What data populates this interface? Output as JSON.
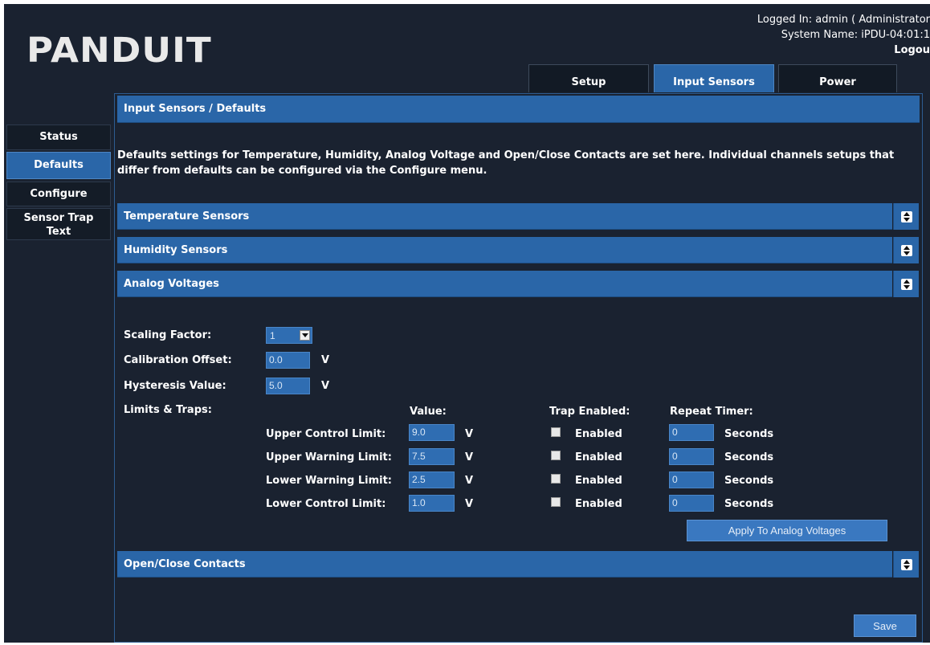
{
  "header": {
    "logo": "PANDUIT",
    "logged_in": "Logged In: admin ( Administrator",
    "system_name": "System Name: iPDU-04:01:1",
    "logout": "Logou"
  },
  "tabs": [
    {
      "label": "Setup",
      "active": false
    },
    {
      "label": "Input Sensors",
      "active": true
    },
    {
      "label": "Power",
      "active": false
    }
  ],
  "sidebar": {
    "items": [
      {
        "label": "Status",
        "active": false
      },
      {
        "label": "Defaults",
        "active": true
      },
      {
        "label": "Configure",
        "active": false
      },
      {
        "label": "Sensor Trap Text",
        "active": false
      }
    ]
  },
  "main": {
    "title": "Input Sensors / Defaults",
    "description": "Defaults settings for Temperature, Humidity, Analog Voltage and Open/Close Contacts are set here. Individual channels setups that differ from defaults can be configured via the Configure menu.",
    "sections": {
      "temperature": "Temperature Sensors",
      "humidity": "Humidity Sensors",
      "analog": "Analog Voltages",
      "contacts": "Open/Close Contacts"
    },
    "analog": {
      "scaling_label": "Scaling Factor:",
      "scaling_value": "1",
      "calibration_label": "Calibration Offset:",
      "calibration_value": "0.0",
      "hysteresis_label": "Hysteresis Value:",
      "hysteresis_value": "5.0",
      "unit": "V",
      "limits_label": "Limits & Traps:",
      "col_value": "Value:",
      "col_trap": "Trap Enabled:",
      "col_repeat": "Repeat Timer:",
      "rows": [
        {
          "label": "Upper Control Limit:",
          "value": "9.0",
          "unit": "V",
          "trap": "Enabled",
          "timer": "0",
          "timer_unit": "Seconds"
        },
        {
          "label": "Upper Warning Limit:",
          "value": "7.5",
          "unit": "V",
          "trap": "Enabled",
          "timer": "0",
          "timer_unit": "Seconds"
        },
        {
          "label": "Lower Warning Limit:",
          "value": "2.5",
          "unit": "V",
          "trap": "Enabled",
          "timer": "0",
          "timer_unit": "Seconds"
        },
        {
          "label": "Lower Control Limit:",
          "value": "1.0",
          "unit": "V",
          "trap": "Enabled",
          "timer": "0",
          "timer_unit": "Seconds"
        }
      ],
      "apply_button": "Apply To Analog Voltages"
    },
    "save_button": "Save"
  }
}
